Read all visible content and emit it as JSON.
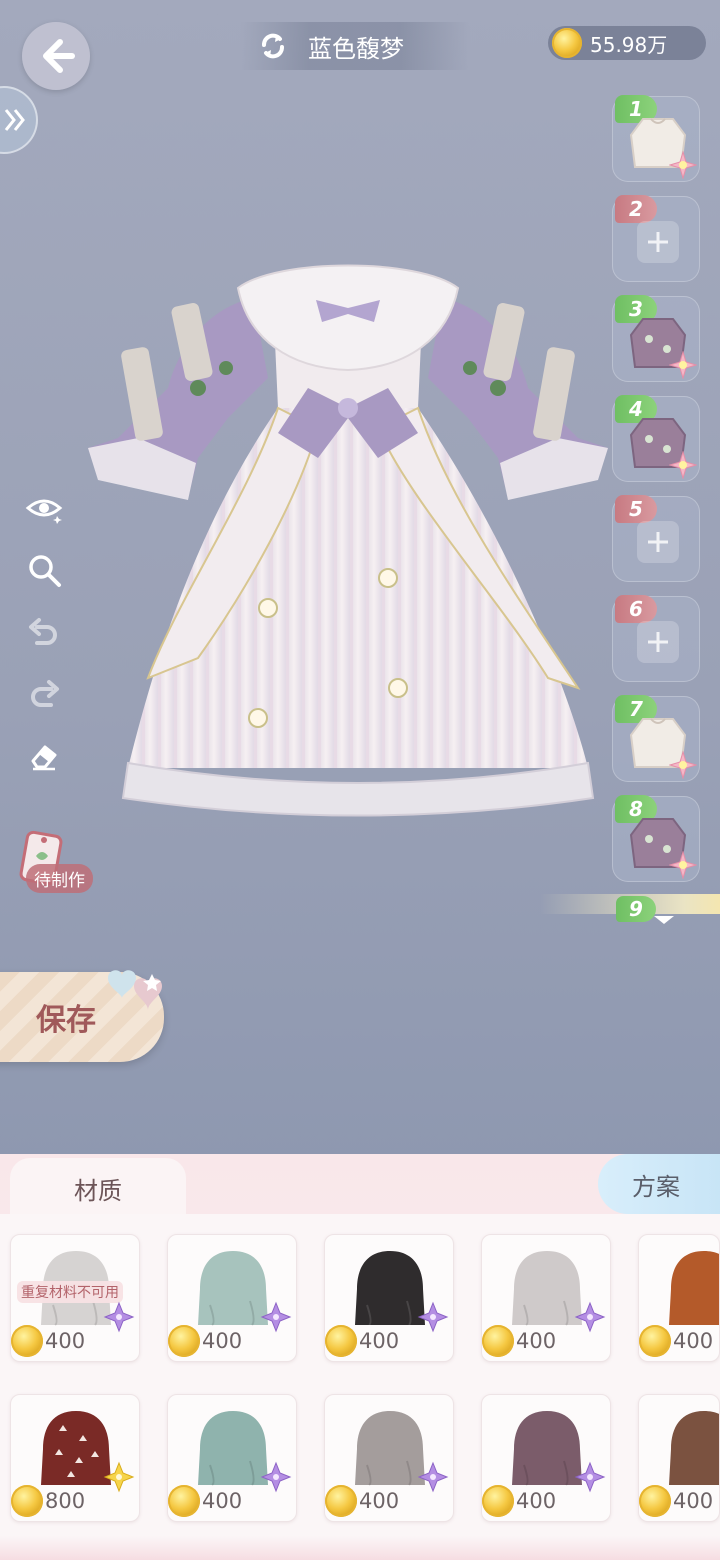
{
  "header": {
    "title": "蓝色馥梦",
    "currency_amount": "55.98万"
  },
  "pending_tag": {
    "label": "待制作"
  },
  "save_button": {
    "label": "保存"
  },
  "slots": [
    {
      "number": "1",
      "state": "filled",
      "item": "cream-blouse"
    },
    {
      "number": "2",
      "state": "empty"
    },
    {
      "number": "3",
      "state": "filled",
      "item": "purple-floral-blouse"
    },
    {
      "number": "4",
      "state": "filled",
      "item": "purple-floral-blouse"
    },
    {
      "number": "5",
      "state": "empty"
    },
    {
      "number": "6",
      "state": "empty"
    },
    {
      "number": "7",
      "state": "filled",
      "item": "cream-blouse"
    },
    {
      "number": "8",
      "state": "filled",
      "item": "purple-floral-blouse"
    },
    {
      "number": "9",
      "state": "partial"
    }
  ],
  "tabs": {
    "material": "材质",
    "plan": "方案"
  },
  "materials": [
    {
      "price": "400",
      "color": "#d6d3d2",
      "badge": "purple-flower",
      "warning": "重复材料不可用"
    },
    {
      "price": "400",
      "color": "#a7c3bd",
      "badge": "purple-flower"
    },
    {
      "price": "400",
      "color": "#2f2c2d",
      "badge": "purple-flower"
    },
    {
      "price": "400",
      "color": "#cfcaca",
      "badge": "purple-flower"
    },
    {
      "price": "400",
      "color": "#b45a2a",
      "badge": "none"
    },
    {
      "price": "800",
      "color": "#7a2a26",
      "badge": "yellow-flower",
      "pattern": "triangles"
    },
    {
      "price": "400",
      "color": "#8fb3ad",
      "badge": "purple-flower"
    },
    {
      "price": "400",
      "color": "#a49d9c",
      "badge": "purple-flower"
    },
    {
      "price": "400",
      "color": "#7b5c6a",
      "badge": "purple-flower"
    },
    {
      "price": "400",
      "color": "#7b5240",
      "badge": "none"
    }
  ]
}
